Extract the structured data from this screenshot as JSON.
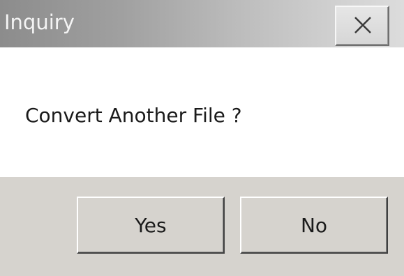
{
  "window": {
    "title": "Inquiry",
    "close_icon": "close-icon"
  },
  "message": {
    "text": "Convert Another File ?"
  },
  "buttons": {
    "yes_label": "Yes",
    "no_label": "No"
  },
  "colors": {
    "titlebar_start": "#8c8c8c",
    "titlebar_end": "#dcdcdc",
    "title_text": "#f4f4f4",
    "button_face": "#d6d3ce",
    "body_background": "#ffffff"
  }
}
